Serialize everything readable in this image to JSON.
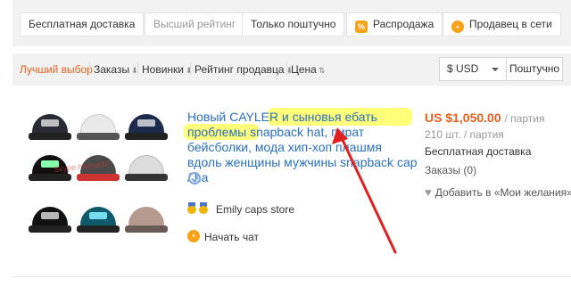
{
  "filters": {
    "free_shipping": "Бесплатная доставка",
    "top_rated": "Высший рейтинг",
    "piece_only": "Только поштучно",
    "sale": "Распродажа",
    "sale_icon": "sale-tag-icon",
    "seller_online": "Продавец в сети",
    "seller_online_icon": "online-seller-icon"
  },
  "sort": {
    "best_match": "Лучший выбор",
    "orders": "Заказы",
    "newest": "Новинки",
    "seller_rating": "Рейтинг продавца",
    "price": "Цена",
    "currency": "$ USD",
    "shipping": "Поштучно"
  },
  "product": {
    "title_a": "Новый CAYLER и сыновья ебать",
    "title_b": "проблемы snapback hat, пират бейсболки, мода хип-хоп плашмя вдоль женщины мужчины snapback cap / ha",
    "watermark": "Skype:hathat99",
    "store_name": "Emily caps store",
    "chat_label": "Начать чат",
    "price": "US $1,050.00",
    "price_unit": "/ партия",
    "quantity": "210 шт. / партия",
    "free_shipping": "Бесплатная доставка",
    "orders": "Заказы (0)",
    "wishlist": "Добавить в «Мои желания»"
  },
  "colors": {
    "accent": "#e8601c",
    "link": "#2b6fbf",
    "highlight": "#ffff6a",
    "annotation_arrow": "#e02020"
  }
}
